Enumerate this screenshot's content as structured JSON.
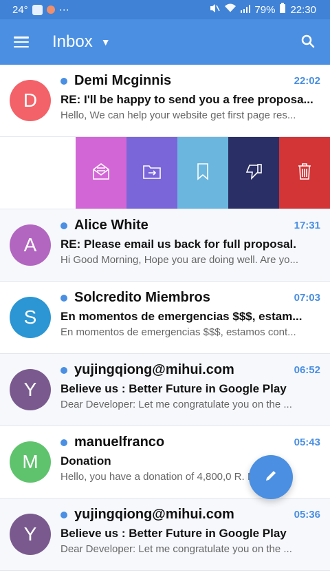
{
  "status_bar": {
    "temperature": "24°",
    "menu_dots": "⋯",
    "battery_percent": "79%",
    "time": "22:30"
  },
  "app_bar": {
    "title": "Inbox",
    "caret": "▼"
  },
  "emails": [
    {
      "initial": "D",
      "avatar_color": "#f36268",
      "sender": "Demi Mcginnis",
      "time": "22:02",
      "subject": "RE: I'll be happy to send you a free proposa...",
      "preview": "Hello, We can help your website get first page res..."
    },
    {
      "initial": "A",
      "avatar_color": "#b266c0",
      "sender": "Alice White",
      "time": "17:31",
      "subject": "RE: Please email us back for full proposal.",
      "preview": "Hi Good Morning, Hope you are doing well. Are yo..."
    },
    {
      "initial": "S",
      "avatar_color": "#2b96d3",
      "sender": "Solcredito Miembros",
      "time": "07:03",
      "subject": "En momentos de emergencias $$$, estam...",
      "preview": "En momentos de emergencias $$$, estamos cont..."
    },
    {
      "initial": "Y",
      "avatar_color": "#7a5a8e",
      "sender": "yujingqiong@mihui.com",
      "time": "06:52",
      "subject": "Believe us : Better Future in Google Play",
      "preview": "Dear Developer:   Let me congratulate you on the ..."
    },
    {
      "initial": "M",
      "avatar_color": "#5fc36d",
      "sender": "manuelfranco",
      "time": "05:43",
      "subject": "Donation",
      "preview": "Hello, you have a donation of 4,800,0          R. I ..."
    },
    {
      "initial": "Y",
      "avatar_color": "#7a5a8e",
      "sender": "yujingqiong@mihui.com",
      "time": "05:36",
      "subject": "Believe us : Better Future in Google Play",
      "preview": "Dear Developer:   Let me congratulate you on the ..."
    }
  ],
  "swipe_actions": [
    {
      "name": "mark-read-icon",
      "color": "#d366d6"
    },
    {
      "name": "move-folder-icon",
      "color": "#7a66d9"
    },
    {
      "name": "bookmark-icon",
      "color": "#6bb6de"
    },
    {
      "name": "thumbs-down-icon",
      "color": "#2a2f66"
    },
    {
      "name": "delete-icon",
      "color": "#d33436"
    }
  ],
  "colors": {
    "primary": "#4a8fe2",
    "status_bar": "#3f82d6"
  }
}
